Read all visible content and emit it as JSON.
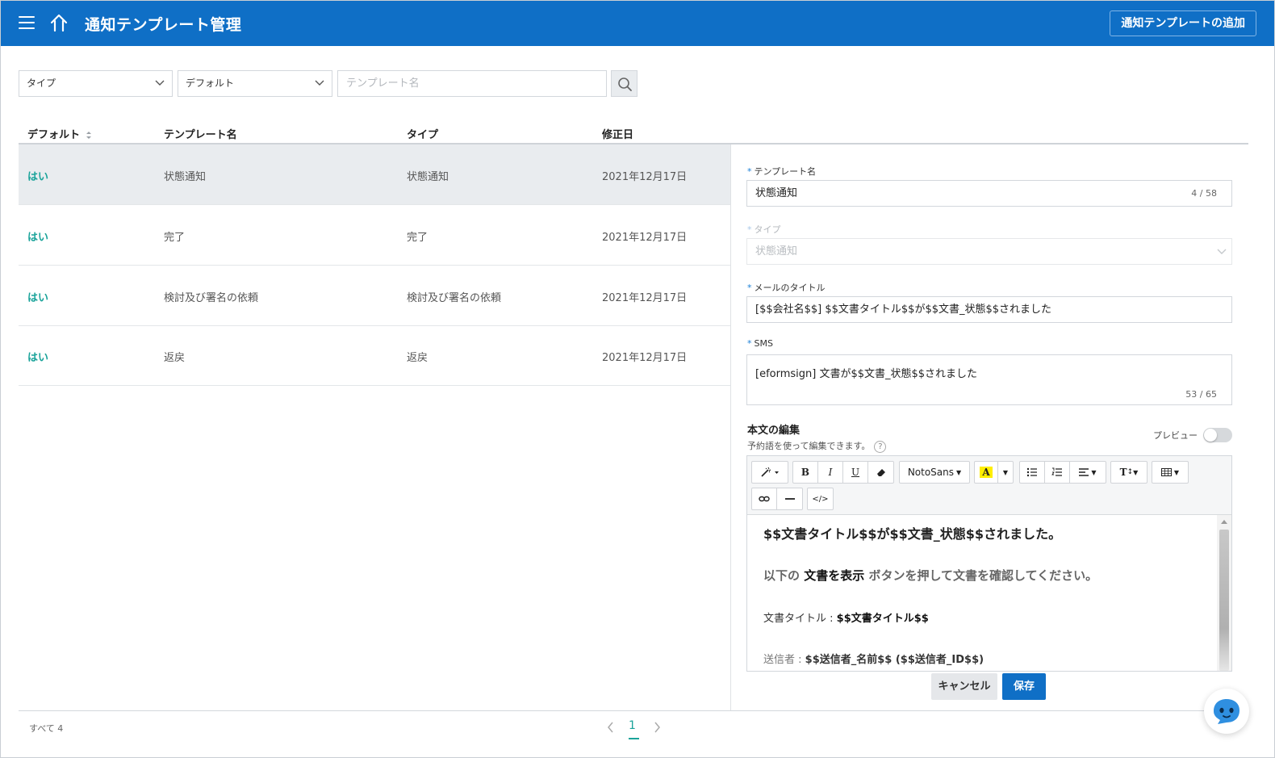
{
  "header": {
    "title": "通知テンプレート管理",
    "add_button": "通知テンプレートの追加"
  },
  "filters": {
    "type_select": "タイプ",
    "default_select": "デフォルト",
    "search_placeholder": "テンプレート名"
  },
  "table": {
    "columns": [
      "デフォルト",
      "テンプレート名",
      "タイプ",
      "修正日"
    ],
    "rows": [
      {
        "default": "はい",
        "name": "状態通知",
        "type": "状態通知",
        "modified": "2021年12月17日"
      },
      {
        "default": "はい",
        "name": "完了",
        "type": "完了",
        "modified": "2021年12月17日"
      },
      {
        "default": "はい",
        "name": "検討及び署名の依頼",
        "type": "検討及び署名の依頼",
        "modified": "2021年12月17日"
      },
      {
        "default": "はい",
        "name": "返戻",
        "type": "返戻",
        "modified": "2021年12月17日"
      }
    ]
  },
  "form": {
    "required_mark": "*",
    "template_name_label": "テンプレート名",
    "template_name_value": "状態通知",
    "template_name_counter": "4 / 58",
    "type_label": "タイプ",
    "type_value": "状態通知",
    "mail_title_label": "メールのタイトル",
    "mail_title_value": "[$$会社名$$] $$文書タイトル$$が$$文書_状態$$されました",
    "sms_label": "SMS",
    "sms_value": "[eformsign] 文書が$$文書_状態$$されました",
    "sms_counter": "53 / 65",
    "body_title": "本文の編集",
    "body_hint": "予約語を使って編集できます。",
    "help_glyph": "?",
    "preview_label": "プレビュー",
    "preview_on": false
  },
  "toolbar": {
    "font_name": "NotoSans",
    "bold": "B",
    "italic": "I",
    "underline": "U",
    "highlight": "A",
    "text_size": "T",
    "code": "</>"
  },
  "editor": {
    "heading": "$$文書タイトル$$が$$文書_状態$$されました。",
    "para_pre": "以下の ",
    "para_strong": "文書を表示",
    "para_post": " ボタンを押して文書を確認してください。",
    "doc_title_label": "文書タイトル : ",
    "doc_title_value": "$$文書タイトル$$",
    "sender_label": "送信者 : ",
    "sender_value": "$$送信者_名前$$ ($$送信者_ID$$)"
  },
  "actions": {
    "cancel": "キャンセル",
    "save": "保存"
  },
  "footer": {
    "total": "すべて 4",
    "current_page": "1"
  },
  "colors": {
    "brand": "#0f6fc6",
    "accent_teal": "#1aa39a",
    "selected_row": "#e9ecef"
  }
}
